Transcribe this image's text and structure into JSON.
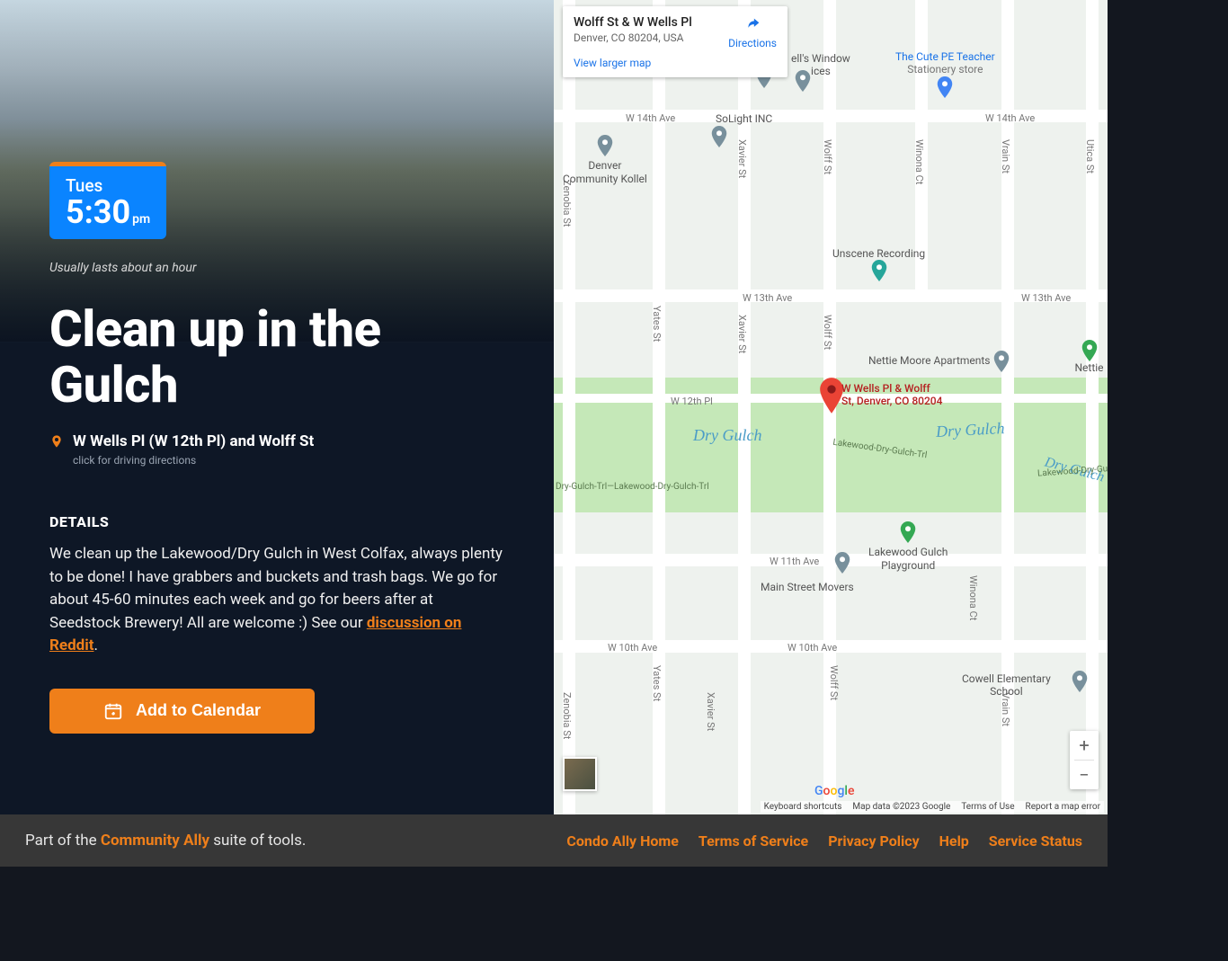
{
  "time_badge": {
    "day": "Tues",
    "time": "5:30",
    "ampm": "pm"
  },
  "duration": "Usually lasts about an hour",
  "title": "Clean up in the Gulch",
  "location": {
    "text": "W Wells Pl (W 12th Pl) and Wolff St",
    "sub": "click for driving directions"
  },
  "details": {
    "heading": "DETAILS",
    "body_pre": "We clean up the Lakewood/Dry Gulch in West Colfax, always plenty to be done! I have grabbers and buckets and trash bags. We go for about 45-60 minutes each week and go for beers after at Seedstock Brewery! All are welcome :) See our ",
    "link_text": "discussion on Reddit",
    "body_post": "."
  },
  "add_calendar": "Add to Calendar",
  "map_card": {
    "title": "Wolff St & W Wells Pl",
    "address": "Denver, CO 80204, USA",
    "view_larger": "View larger map",
    "directions": "Directions"
  },
  "map": {
    "marker_label_l1": "W Wells Pl & Wolff",
    "marker_label_l2": "St, Denver, CO 80204",
    "roads": {
      "w14th": "W 14th Ave",
      "w13th": "W 13th Ave",
      "w12thpl": "W 12th Pl",
      "w11th": "W 11th Ave",
      "w10th": "W 10th Ave",
      "zenobia": "Zenobia St",
      "yates": "Yates St",
      "xavier": "Xavier St",
      "wolff": "Wolff St",
      "winona": "Winona Ct",
      "vrain": "Vrain St",
      "utica": "Utica St"
    },
    "creek": "Dry Gulch",
    "trail_left": "Dry-Gulch-Trl—Lakewood-Dry-Gulch-Trl",
    "trail_right": "Lakewood-Dry-Gulch-Trl",
    "pois": {
      "teacher_l1": "The Cute PE Teacher",
      "teacher_l2": "Stationery store",
      "window_l1": "ell's Window",
      "window_l2": "ices",
      "solight": "SoLight INC",
      "kollel_l1": "Denver",
      "kollel_l2": "Community Kollel",
      "unscene": "Unscene Recording",
      "nettie_apts": "Nettie Moore Apartments",
      "nettie": "Nettie",
      "playground_l1": "Lakewood Gulch",
      "playground_l2": "Playground",
      "movers": "Main Street Movers",
      "cowell_l1": "Cowell Elementary",
      "cowell_l2": "School"
    },
    "attrib": {
      "shortcuts": "Keyboard shortcuts",
      "data": "Map data ©2023 Google",
      "terms": "Terms of Use",
      "report": "Report a map error"
    }
  },
  "footer": {
    "left_pre": "Part of the ",
    "left_link": "Community Ally",
    "left_post": " suite of tools.",
    "links": [
      "Condo Ally Home",
      "Terms of Service",
      "Privacy Policy",
      "Help",
      "Service Status"
    ]
  }
}
